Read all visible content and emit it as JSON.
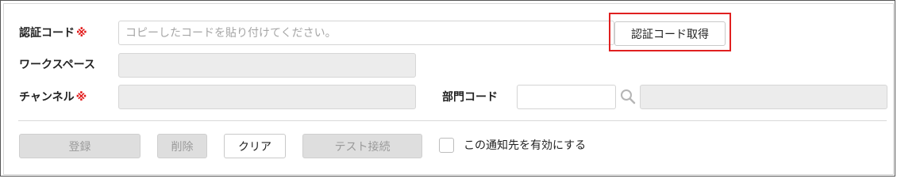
{
  "form": {
    "auth_code": {
      "label": "認証コード",
      "required_mark": "※",
      "placeholder": "コピーしたコードを貼り付けてください。",
      "value": ""
    },
    "get_auth_code_button": "認証コード取得",
    "workspace": {
      "label": "ワークスペース",
      "value": ""
    },
    "channel": {
      "label": "チャンネル",
      "required_mark": "※",
      "value": ""
    },
    "department_code": {
      "label": "部門コード",
      "code_value": "",
      "name_value": ""
    }
  },
  "actions": {
    "register": "登録",
    "delete": "削除",
    "clear": "クリア",
    "test_connection": "テスト接続"
  },
  "enable_notification": {
    "label": "この通知先を有効にする",
    "checked": false
  },
  "colors": {
    "required": "#e21c1c",
    "highlight_border": "#e02020",
    "disabled_bg": "#dedede"
  }
}
